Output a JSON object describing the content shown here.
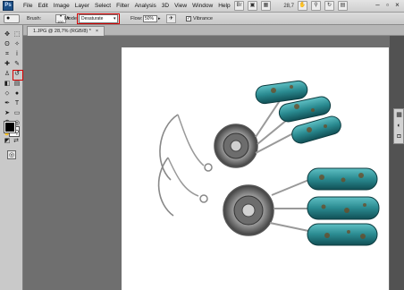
{
  "app": {
    "logo_text": "Ps"
  },
  "menu": [
    "File",
    "Edit",
    "Image",
    "Layer",
    "Select",
    "Filter",
    "Analysis",
    "3D",
    "View",
    "Window",
    "Help"
  ],
  "menubar_right": {
    "zoom": "28,7",
    "icons": [
      "bridge-icon",
      "mini-bridge-icon",
      "screen-mode-icon",
      "hand-icon",
      "zoom-tool-icon",
      "rotate-icon",
      "arrange-icon"
    ]
  },
  "window_controls": {
    "minimize": "–",
    "restore": "▫",
    "close": "×"
  },
  "options": {
    "brush_label": "Brush:",
    "brush_size": "100",
    "mode_label": "Mode:",
    "mode_value": "Desaturate",
    "flow_label": "Flow:",
    "flow_value": "50%",
    "vibrance_label": "Vibrance",
    "vibrance_checked": true
  },
  "document": {
    "tab_label": "1.JPG @ 28,7% (RGB/8) *",
    "tab_close": "×"
  },
  "toolbox": {
    "tools": [
      {
        "name": "move-tool-icon",
        "glyph": "✥"
      },
      {
        "name": "marquee-tool-icon",
        "glyph": "⬚"
      },
      {
        "name": "lasso-tool-icon",
        "glyph": "ʘ"
      },
      {
        "name": "quick-select-tool-icon",
        "glyph": "✧"
      },
      {
        "name": "crop-tool-icon",
        "glyph": "⌗"
      },
      {
        "name": "eyedropper-tool-icon",
        "glyph": "ⅰ"
      },
      {
        "name": "healing-brush-tool-icon",
        "glyph": "✚"
      },
      {
        "name": "brush-tool-icon",
        "glyph": "✎"
      },
      {
        "name": "clone-stamp-tool-icon",
        "glyph": "♙"
      },
      {
        "name": "history-brush-tool-icon",
        "glyph": "↺"
      },
      {
        "name": "eraser-tool-icon",
        "glyph": "◧"
      },
      {
        "name": "gradient-tool-icon",
        "glyph": "▤"
      },
      {
        "name": "blur-tool-icon",
        "glyph": "⬦"
      },
      {
        "name": "sponge-tool-icon",
        "glyph": "●"
      },
      {
        "name": "pen-tool-icon",
        "glyph": "✒"
      },
      {
        "name": "type-tool-icon",
        "glyph": "T"
      },
      {
        "name": "path-select-tool-icon",
        "glyph": "➤"
      },
      {
        "name": "shape-tool-icon",
        "glyph": "▭"
      },
      {
        "name": "3d-rotate-tool-icon",
        "glyph": "❂"
      },
      {
        "name": "3d-orbit-tool-icon",
        "glyph": "◎"
      },
      {
        "name": "hand-tool-icon",
        "glyph": "✋"
      },
      {
        "name": "zoom-tool-icon",
        "glyph": "⚲"
      }
    ],
    "selected_tool": "sponge-tool-icon"
  },
  "colors": {
    "highlight": "#d40000",
    "foreground": "#000000",
    "background": "#ffffff",
    "turquoise": "#2a8a90"
  },
  "dock": {
    "icons": [
      "swatches-icon",
      "adjustments-icon"
    ]
  }
}
